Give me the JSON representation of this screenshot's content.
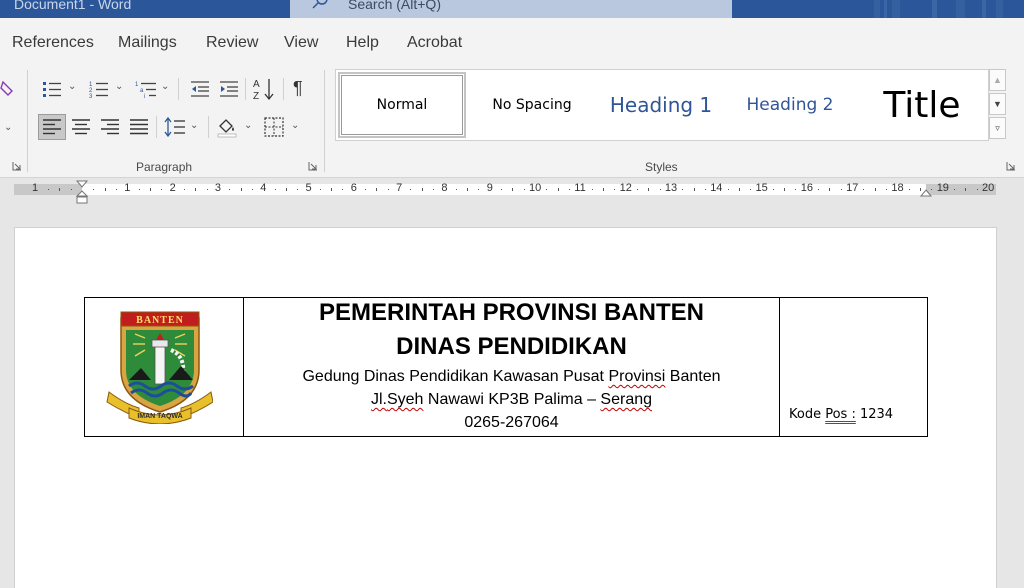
{
  "titlebar": {
    "doc_title": "Document1  -  Word",
    "search_placeholder": "Search (Alt+Q)"
  },
  "menu": {
    "items": [
      "References",
      "Mailings",
      "Review",
      "View",
      "Help",
      "Acrobat"
    ]
  },
  "ribbon": {
    "paragraph_group_label": "Paragraph",
    "styles_group_label": "Styles",
    "styles": [
      {
        "label": "Normal"
      },
      {
        "label": "No Spacing"
      },
      {
        "label": "Heading 1"
      },
      {
        "label": "Heading 2"
      },
      {
        "label": "Title"
      }
    ],
    "icons": [
      "bullets-icon",
      "numbering-icon",
      "multilevel-list-icon",
      "decrease-indent-icon",
      "increase-indent-icon",
      "sort-icon",
      "show-formatting-icon",
      "align-left-icon",
      "align-center-icon",
      "align-right-icon",
      "justify-icon",
      "line-spacing-icon",
      "shading-icon",
      "borders-icon"
    ]
  },
  "ruler": {
    "left_numbers": [
      "1"
    ],
    "numbers": [
      "1",
      "2",
      "3",
      "4",
      "5",
      "6",
      "7",
      "8",
      "9",
      "10",
      "11",
      "12",
      "13",
      "14",
      "15",
      "16",
      "17",
      "18",
      "19",
      "20"
    ]
  },
  "document": {
    "heading_line1": "PEMERINTAH PROVINSI BANTEN",
    "heading_line2": "DINAS PENDIDIKAN",
    "address_line1_a": "Gedung Dinas Pendidikan Kawasan Pusat ",
    "address_line1_b": "Provinsi",
    "address_line1_c": " Banten",
    "address_line2_a": "Jl.",
    "address_line2_b": "Syeh",
    "address_line2_c": " Nawawi KP3B Palima – ",
    "address_line2_d": "Serang",
    "phone": "0265-267064",
    "kode_label": "Kode ",
    "kode_pos": "Pos :",
    "kode_value": " 1234",
    "logo_banner": "BANTEN",
    "logo_motto": "IMAN TAQWA"
  },
  "colors": {
    "titlebar": "#2b579a",
    "ribbon_bg": "#f3f3f3",
    "heading_style_blue": "#2f5597",
    "spell_error": "#c00000"
  }
}
